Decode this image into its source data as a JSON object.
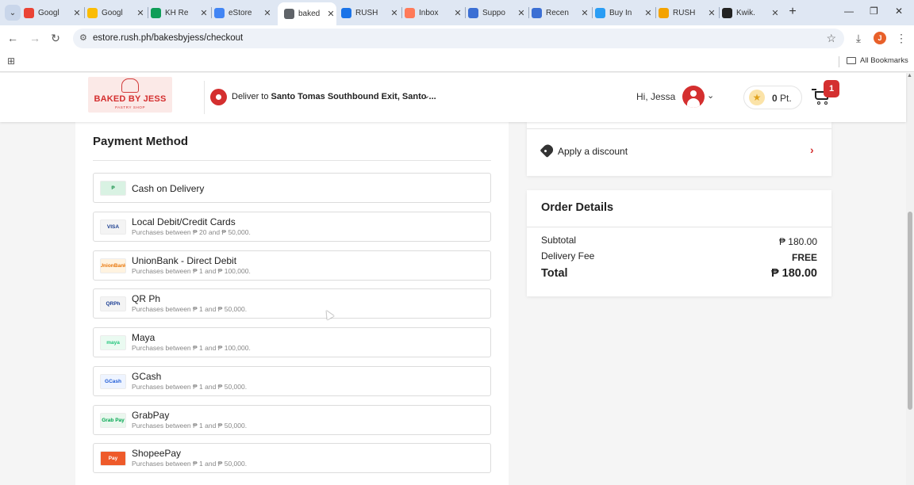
{
  "browser": {
    "tabs": [
      {
        "title": "Googl",
        "icon": "gmail-icon",
        "color": "#ea4335"
      },
      {
        "title": "Googl",
        "icon": "google-drive-icon",
        "color": "#fbbc04"
      },
      {
        "title": "KH Re",
        "icon": "sheets-icon",
        "color": "#0f9d58"
      },
      {
        "title": "eStore",
        "icon": "docs-icon",
        "color": "#4285f4"
      },
      {
        "title": "baked",
        "icon": "globe-icon",
        "color": "#5f6368"
      },
      {
        "title": "RUSH",
        "icon": "meet-icon",
        "color": "#1a73e8"
      },
      {
        "title": "Inbox",
        "icon": "hubspot-icon",
        "color": "#ff7a59"
      },
      {
        "title": "Suppo",
        "icon": "link-icon",
        "color": "#3b6fd4"
      },
      {
        "title": "Recen",
        "icon": "link-icon",
        "color": "#3b6fd4"
      },
      {
        "title": "Buy In",
        "icon": "x-brand-icon",
        "color": "#2a9df4"
      },
      {
        "title": "RUSH",
        "icon": "rush-icon",
        "color": "#f4a300"
      },
      {
        "title": "Kwik.",
        "icon": "kwik-icon",
        "color": "#222222"
      }
    ],
    "active_tab": 4,
    "url": "estore.rush.ph/bakesbyjess/checkout",
    "profile_initial": "J",
    "all_bookmarks_label": "All Bookmarks"
  },
  "header": {
    "logo_name": "BAKED BY JESS",
    "logo_sub": "PASTRY SHOP",
    "deliver_prefix": "Deliver to",
    "deliver_address": "Santo Tomas Southbound Exit, Santo ...",
    "greeting": "Hi, Jessa",
    "points_value": "0",
    "points_unit": "Pt.",
    "cart_count": "1",
    "brand_color": "#d42f2f"
  },
  "payment": {
    "title": "Payment Method",
    "methods": [
      {
        "name": "Cash on Delivery",
        "sub": "",
        "icon": "cash-icon",
        "icon_text": "₱"
      },
      {
        "name": "Local Debit/Credit Cards",
        "sub": "Purchases between ₱ 20 and ₱ 50,000.",
        "icon": "card-icon",
        "icon_text": "VISA"
      },
      {
        "name": "UnionBank - Direct Debit",
        "sub": "Purchases between ₱ 1 and ₱ 100,000.",
        "icon": "unionbank-icon",
        "icon_text": "UnionBank"
      },
      {
        "name": "QR Ph",
        "sub": "Purchases between ₱ 1 and ₱ 50,000.",
        "icon": "qrph-icon",
        "icon_text": "QRPh"
      },
      {
        "name": "Maya",
        "sub": "Purchases between ₱ 1 and ₱ 100,000.",
        "icon": "maya-icon",
        "icon_text": "maya"
      },
      {
        "name": "GCash",
        "sub": "Purchases between ₱ 1 and ₱ 50,000.",
        "icon": "gcash-icon",
        "icon_text": "GCash"
      },
      {
        "name": "GrabPay",
        "sub": "Purchases between ₱ 1 and ₱ 50,000.",
        "icon": "grabpay-icon",
        "icon_text": "Grab Pay"
      },
      {
        "name": "ShopeePay",
        "sub": "Purchases between ₱ 1 and ₱ 50,000.",
        "icon": "shopeepay-icon",
        "icon_text": "Pay"
      }
    ]
  },
  "discount": {
    "label": "Apply a discount"
  },
  "order": {
    "title": "Order Details",
    "subtotal_label": "Subtotal",
    "subtotal_value": "₱ 180.00",
    "delivery_label": "Delivery Fee",
    "delivery_value": "FREE",
    "total_label": "Total",
    "total_value": "₱ 180.00"
  }
}
